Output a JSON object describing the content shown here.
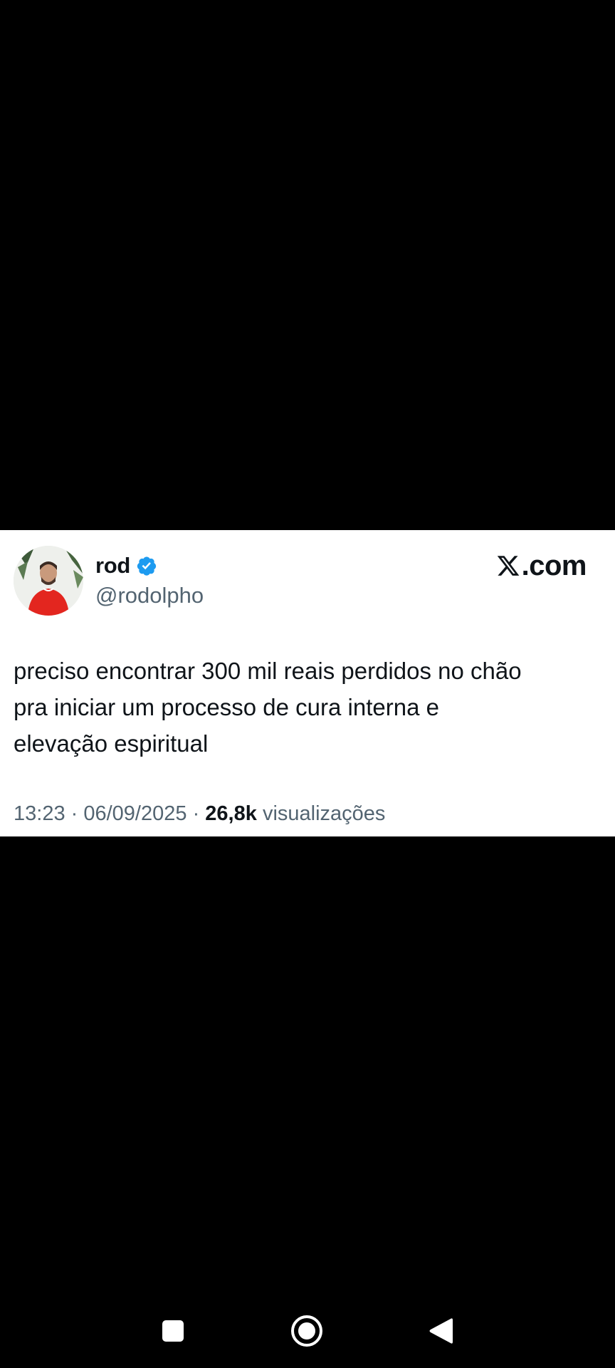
{
  "tweet": {
    "display_name": "rod",
    "verified": true,
    "handle": "@rodolpho",
    "brand": "X.com",
    "brand_domain": ".com",
    "text_lines": [
      "preciso encontrar 300 mil reais perdidos no chão",
      "pra iniciar um processo de cura interna e",
      "elevação espiritual"
    ],
    "time": "13:23",
    "separator": " · ",
    "date": "06/09/2025",
    "views_count": "26,8k",
    "views_label": "visualizações"
  },
  "colors": {
    "background": "#000000",
    "card": "#ffffff",
    "text_primary": "#0f1419",
    "text_secondary": "#536471",
    "verified_blue": "#1d9bf0",
    "nav_icons": "#ffffff"
  },
  "icons": {
    "verified": "verified-badge-icon",
    "brand_logo": "x-logo-icon",
    "nav_recents": "square-recents-icon",
    "nav_home": "circle-home-icon",
    "nav_back": "triangle-back-icon"
  }
}
